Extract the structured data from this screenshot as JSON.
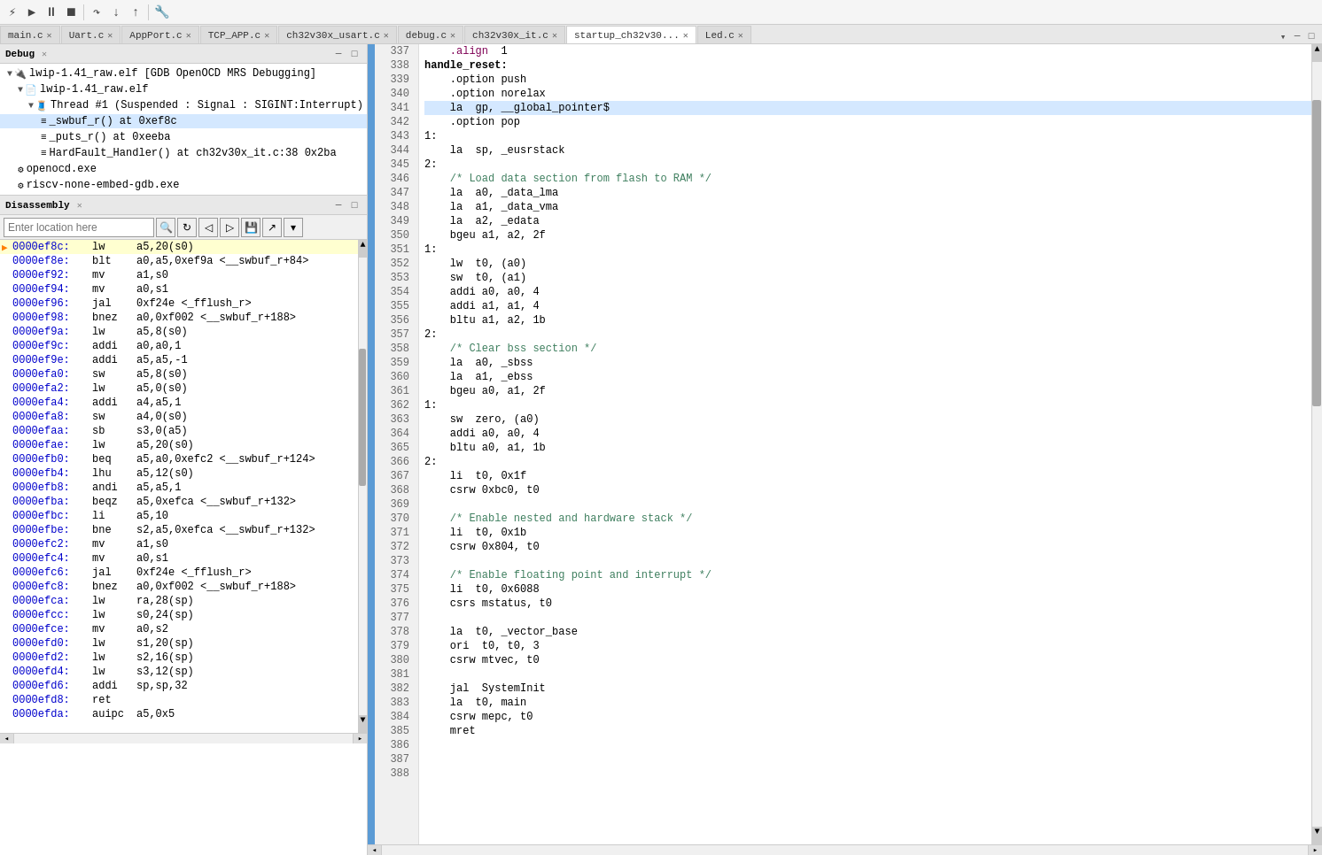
{
  "toolbar": {
    "title": "Debug"
  },
  "tabs": [
    {
      "label": "main.c",
      "active": false,
      "closable": true
    },
    {
      "label": "Uart.c",
      "active": false,
      "closable": true
    },
    {
      "label": "AppPort.c",
      "active": false,
      "closable": true
    },
    {
      "label": "TCP_APP.c",
      "active": false,
      "closable": true
    },
    {
      "label": "ch32v30x_usart.c",
      "active": false,
      "closable": true
    },
    {
      "label": "debug.c",
      "active": false,
      "closable": true
    },
    {
      "label": "ch32v30x_it.c",
      "active": false,
      "closable": true
    },
    {
      "label": "startup_ch32v30...",
      "active": true,
      "closable": true
    },
    {
      "label": "Led.c",
      "active": false,
      "closable": true
    }
  ],
  "debug_panel": {
    "title": "Debug",
    "tree": [
      {
        "indent": 0,
        "arrow": "▼",
        "icon": "🔌",
        "label": "lwip-1.41_raw.elf [GDB OpenOCD MRS Debugging]",
        "bold": false
      },
      {
        "indent": 1,
        "arrow": "▼",
        "icon": "📁",
        "label": "lwip-1.41_raw.elf",
        "bold": false
      },
      {
        "indent": 2,
        "arrow": "▼",
        "icon": "🧵",
        "label": "Thread #1 (Suspended : Signal : SIGINT:Interrupt)",
        "bold": false
      },
      {
        "indent": 3,
        "arrow": "",
        "icon": "≡",
        "label": "_swbuf_r() at 0xef8c",
        "bold": false,
        "highlight": true
      },
      {
        "indent": 3,
        "arrow": "",
        "icon": "≡",
        "label": "_puts_r() at 0xeeba",
        "bold": false
      },
      {
        "indent": 3,
        "arrow": "",
        "icon": "≡",
        "label": "HardFault_Handler() at ch32v30x_it.c:38 0x2ba",
        "bold": false
      },
      {
        "indent": 1,
        "arrow": "",
        "icon": "⚙",
        "label": "openocd.exe",
        "bold": false
      },
      {
        "indent": 1,
        "arrow": "",
        "icon": "⚙",
        "label": "riscv-none-embed-gdb.exe",
        "bold": false
      }
    ]
  },
  "disasm_panel": {
    "title": "Disassembly",
    "location_placeholder": "Enter location here",
    "lines": [
      {
        "arrow": "▶",
        "addr": "0000ef8c:",
        "mnem": "lw",
        "ops": "a5,20(s0)",
        "current": true
      },
      {
        "arrow": "",
        "addr": "0000ef8e:",
        "mnem": "blt",
        "ops": "a0,a5,0xef9a <__swbuf_r+84>"
      },
      {
        "arrow": "",
        "addr": "0000ef92:",
        "mnem": "mv",
        "ops": "a1,s0"
      },
      {
        "arrow": "",
        "addr": "0000ef94:",
        "mnem": "mv",
        "ops": "a0,s1"
      },
      {
        "arrow": "",
        "addr": "0000ef96:",
        "mnem": "jal",
        "ops": "0xf24e <_fflush_r>"
      },
      {
        "arrow": "",
        "addr": "0000ef98:",
        "mnem": "bnez",
        "ops": "a0,0xf002 <__swbuf_r+188>"
      },
      {
        "arrow": "",
        "addr": "0000ef9a:",
        "mnem": "lw",
        "ops": "a5,8(s0)"
      },
      {
        "arrow": "",
        "addr": "0000ef9c:",
        "mnem": "addi",
        "ops": "a0,a0,1"
      },
      {
        "arrow": "",
        "addr": "0000ef9e:",
        "mnem": "addi",
        "ops": "a5,a5,-1"
      },
      {
        "arrow": "",
        "addr": "0000efa0:",
        "mnem": "sw",
        "ops": "a5,8(s0)"
      },
      {
        "arrow": "",
        "addr": "0000efa2:",
        "mnem": "lw",
        "ops": "a5,0(s0)"
      },
      {
        "arrow": "",
        "addr": "0000efa4:",
        "mnem": "addi",
        "ops": "a4,a5,1"
      },
      {
        "arrow": "",
        "addr": "0000efa8:",
        "mnem": "sw",
        "ops": "a4,0(s0)"
      },
      {
        "arrow": "",
        "addr": "0000efaa:",
        "mnem": "sb",
        "ops": "s3,0(a5)"
      },
      {
        "arrow": "",
        "addr": "0000efae:",
        "mnem": "lw",
        "ops": "a5,20(s0)"
      },
      {
        "arrow": "",
        "addr": "0000efb0:",
        "mnem": "beq",
        "ops": "a5,a0,0xefc2 <__swbuf_r+124>"
      },
      {
        "arrow": "",
        "addr": "0000efb4:",
        "mnem": "lhu",
        "ops": "a5,12(s0)"
      },
      {
        "arrow": "",
        "addr": "0000efb8:",
        "mnem": "andi",
        "ops": "a5,a5,1"
      },
      {
        "arrow": "",
        "addr": "0000efba:",
        "mnem": "beqz",
        "ops": "a5,0xefca <__swbuf_r+132>"
      },
      {
        "arrow": "",
        "addr": "0000efbc:",
        "mnem": "li",
        "ops": "a5,10"
      },
      {
        "arrow": "",
        "addr": "0000efbe:",
        "mnem": "bne",
        "ops": "s2,a5,0xefca <__swbuf_r+132>"
      },
      {
        "arrow": "",
        "addr": "0000efc2:",
        "mnem": "mv",
        "ops": "a1,s0"
      },
      {
        "arrow": "",
        "addr": "0000efc4:",
        "mnem": "mv",
        "ops": "a0,s1"
      },
      {
        "arrow": "",
        "addr": "0000efc6:",
        "mnem": "jal",
        "ops": "0xf24e <_fflush_r>"
      },
      {
        "arrow": "",
        "addr": "0000efc8:",
        "mnem": "bnez",
        "ops": "a0,0xf002 <__swbuf_r+188>"
      },
      {
        "arrow": "",
        "addr": "0000efca:",
        "mnem": "lw",
        "ops": "ra,28(sp)"
      },
      {
        "arrow": "",
        "addr": "0000efcc:",
        "mnem": "lw",
        "ops": "s0,24(sp)"
      },
      {
        "arrow": "",
        "addr": "0000efce:",
        "mnem": "mv",
        "ops": "a0,s2"
      },
      {
        "arrow": "",
        "addr": "0000efd0:",
        "mnem": "lw",
        "ops": "s1,20(sp)"
      },
      {
        "arrow": "",
        "addr": "0000efd2:",
        "mnem": "lw",
        "ops": "s2,16(sp)"
      },
      {
        "arrow": "",
        "addr": "0000efd4:",
        "mnem": "lw",
        "ops": "s3,12(sp)"
      },
      {
        "arrow": "",
        "addr": "0000efd6:",
        "mnem": "addi",
        "ops": "sp,sp,32"
      },
      {
        "arrow": "",
        "addr": "0000efd8:",
        "mnem": "ret",
        "ops": ""
      },
      {
        "arrow": "",
        "addr": "0000efda:",
        "mnem": "auipc",
        "ops": "a5,0x5"
      }
    ]
  },
  "code_panel": {
    "lines": [
      {
        "num": 337,
        "text": "\t.align\t1",
        "highlight": false
      },
      {
        "num": 338,
        "text": "handle_reset:",
        "highlight": false
      },
      {
        "num": 339,
        "text": "\t.option push",
        "highlight": false
      },
      {
        "num": 340,
        "text": "\t.option norelax",
        "highlight": false
      },
      {
        "num": 341,
        "text": "\tla\tgp, __global_pointer$",
        "highlight": true
      },
      {
        "num": 342,
        "text": "\t.option pop",
        "highlight": false
      },
      {
        "num": 343,
        "text": "1:",
        "highlight": false
      },
      {
        "num": 344,
        "text": "\tla\tsp, _eusrstack",
        "highlight": false
      },
      {
        "num": 345,
        "text": "2:",
        "highlight": false
      },
      {
        "num": 346,
        "text": "\t/* Load data section from flash to RAM */",
        "highlight": false
      },
      {
        "num": 347,
        "text": "\tla\ta0, _data_lma",
        "highlight": false
      },
      {
        "num": 348,
        "text": "\tla\ta1, _data_vma",
        "highlight": false
      },
      {
        "num": 349,
        "text": "\tla\ta2, _edata",
        "highlight": false
      },
      {
        "num": 350,
        "text": "\tbgeu\ta1, a2, 2f",
        "highlight": false
      },
      {
        "num": 351,
        "text": "1:",
        "highlight": false
      },
      {
        "num": 352,
        "text": "\tlw\tt0, (a0)",
        "highlight": false
      },
      {
        "num": 353,
        "text": "\tsw\tt0, (a1)",
        "highlight": false
      },
      {
        "num": 354,
        "text": "\taddi\ta0, a0, 4",
        "highlight": false
      },
      {
        "num": 355,
        "text": "\taddi\ta1, a1, 4",
        "highlight": false
      },
      {
        "num": 356,
        "text": "\tbltu\ta1, a2, 1b",
        "highlight": false
      },
      {
        "num": 357,
        "text": "2:",
        "highlight": false
      },
      {
        "num": 358,
        "text": "\t/* Clear bss section */",
        "highlight": false
      },
      {
        "num": 359,
        "text": "\tla\ta0, _sbss",
        "highlight": false
      },
      {
        "num": 360,
        "text": "\tla\ta1, _ebss",
        "highlight": false
      },
      {
        "num": 361,
        "text": "\tbgeu\ta0, a1, 2f",
        "highlight": false
      },
      {
        "num": 362,
        "text": "1:",
        "highlight": false
      },
      {
        "num": 363,
        "text": "\tsw\tzero, (a0)",
        "highlight": false
      },
      {
        "num": 364,
        "text": "\taddi\ta0, a0, 4",
        "highlight": false
      },
      {
        "num": 365,
        "text": "\tbltu\ta0, a1, 1b",
        "highlight": false
      },
      {
        "num": 366,
        "text": "2:",
        "highlight": false
      },
      {
        "num": 367,
        "text": "\tli\tt0, 0x1f",
        "highlight": false
      },
      {
        "num": 368,
        "text": "\tcsrw\t0xbc0, t0",
        "highlight": false
      },
      {
        "num": 369,
        "text": "",
        "highlight": false
      },
      {
        "num": 370,
        "text": "\t/* Enable nested and hardware stack */",
        "highlight": false
      },
      {
        "num": 371,
        "text": "\tli\tt0, 0x1b",
        "highlight": false
      },
      {
        "num": 372,
        "text": "\tcsrw\t0x804, t0",
        "highlight": false
      },
      {
        "num": 373,
        "text": "",
        "highlight": false
      },
      {
        "num": 374,
        "text": "\t/* Enable floating point and interrupt */",
        "highlight": false
      },
      {
        "num": 375,
        "text": "\tli\tt0, 0x6088",
        "highlight": false
      },
      {
        "num": 376,
        "text": "\tcsrs\tmstatus, t0",
        "highlight": false
      },
      {
        "num": 377,
        "text": "",
        "highlight": false
      },
      {
        "num": 378,
        "text": "\tla\tt0, _vector_base",
        "highlight": false
      },
      {
        "num": 379,
        "text": "\tori\tt0, t0, 3",
        "highlight": false
      },
      {
        "num": 380,
        "text": "\tcsrw\tmtvec, t0",
        "highlight": false
      },
      {
        "num": 381,
        "text": "",
        "highlight": false
      },
      {
        "num": 382,
        "text": "\tjal \tSystemInit",
        "highlight": false
      },
      {
        "num": 383,
        "text": "\tla\tt0, main",
        "highlight": false
      },
      {
        "num": 384,
        "text": "\tcsrw\tmepc, t0",
        "highlight": false
      },
      {
        "num": 385,
        "text": "\tmret",
        "highlight": false
      },
      {
        "num": 386,
        "text": "",
        "highlight": false
      },
      {
        "num": 387,
        "text": "",
        "highlight": false
      },
      {
        "num": 388,
        "text": "",
        "highlight": false
      }
    ]
  }
}
